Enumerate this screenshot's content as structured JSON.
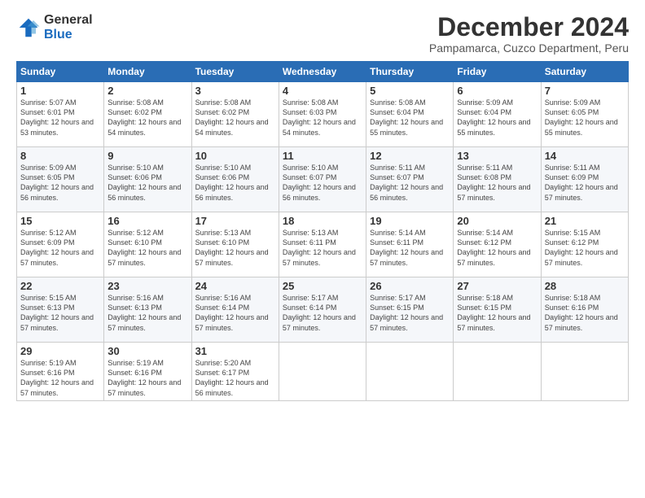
{
  "logo": {
    "general": "General",
    "blue": "Blue"
  },
  "header": {
    "title": "December 2024",
    "subtitle": "Pampamarca, Cuzco Department, Peru"
  },
  "weekdays": [
    "Sunday",
    "Monday",
    "Tuesday",
    "Wednesday",
    "Thursday",
    "Friday",
    "Saturday"
  ],
  "weeks": [
    [
      {
        "day": "1",
        "sunrise": "5:07 AM",
        "sunset": "6:01 PM",
        "daylight": "12 hours and 53 minutes."
      },
      {
        "day": "2",
        "sunrise": "5:08 AM",
        "sunset": "6:02 PM",
        "daylight": "12 hours and 54 minutes."
      },
      {
        "day": "3",
        "sunrise": "5:08 AM",
        "sunset": "6:02 PM",
        "daylight": "12 hours and 54 minutes."
      },
      {
        "day": "4",
        "sunrise": "5:08 AM",
        "sunset": "6:03 PM",
        "daylight": "12 hours and 54 minutes."
      },
      {
        "day": "5",
        "sunrise": "5:08 AM",
        "sunset": "6:04 PM",
        "daylight": "12 hours and 55 minutes."
      },
      {
        "day": "6",
        "sunrise": "5:09 AM",
        "sunset": "6:04 PM",
        "daylight": "12 hours and 55 minutes."
      },
      {
        "day": "7",
        "sunrise": "5:09 AM",
        "sunset": "6:05 PM",
        "daylight": "12 hours and 55 minutes."
      }
    ],
    [
      {
        "day": "8",
        "sunrise": "5:09 AM",
        "sunset": "6:05 PM",
        "daylight": "12 hours and 56 minutes."
      },
      {
        "day": "9",
        "sunrise": "5:10 AM",
        "sunset": "6:06 PM",
        "daylight": "12 hours and 56 minutes."
      },
      {
        "day": "10",
        "sunrise": "5:10 AM",
        "sunset": "6:06 PM",
        "daylight": "12 hours and 56 minutes."
      },
      {
        "day": "11",
        "sunrise": "5:10 AM",
        "sunset": "6:07 PM",
        "daylight": "12 hours and 56 minutes."
      },
      {
        "day": "12",
        "sunrise": "5:11 AM",
        "sunset": "6:07 PM",
        "daylight": "12 hours and 56 minutes."
      },
      {
        "day": "13",
        "sunrise": "5:11 AM",
        "sunset": "6:08 PM",
        "daylight": "12 hours and 57 minutes."
      },
      {
        "day": "14",
        "sunrise": "5:11 AM",
        "sunset": "6:09 PM",
        "daylight": "12 hours and 57 minutes."
      }
    ],
    [
      {
        "day": "15",
        "sunrise": "5:12 AM",
        "sunset": "6:09 PM",
        "daylight": "12 hours and 57 minutes."
      },
      {
        "day": "16",
        "sunrise": "5:12 AM",
        "sunset": "6:10 PM",
        "daylight": "12 hours and 57 minutes."
      },
      {
        "day": "17",
        "sunrise": "5:13 AM",
        "sunset": "6:10 PM",
        "daylight": "12 hours and 57 minutes."
      },
      {
        "day": "18",
        "sunrise": "5:13 AM",
        "sunset": "6:11 PM",
        "daylight": "12 hours and 57 minutes."
      },
      {
        "day": "19",
        "sunrise": "5:14 AM",
        "sunset": "6:11 PM",
        "daylight": "12 hours and 57 minutes."
      },
      {
        "day": "20",
        "sunrise": "5:14 AM",
        "sunset": "6:12 PM",
        "daylight": "12 hours and 57 minutes."
      },
      {
        "day": "21",
        "sunrise": "5:15 AM",
        "sunset": "6:12 PM",
        "daylight": "12 hours and 57 minutes."
      }
    ],
    [
      {
        "day": "22",
        "sunrise": "5:15 AM",
        "sunset": "6:13 PM",
        "daylight": "12 hours and 57 minutes."
      },
      {
        "day": "23",
        "sunrise": "5:16 AM",
        "sunset": "6:13 PM",
        "daylight": "12 hours and 57 minutes."
      },
      {
        "day": "24",
        "sunrise": "5:16 AM",
        "sunset": "6:14 PM",
        "daylight": "12 hours and 57 minutes."
      },
      {
        "day": "25",
        "sunrise": "5:17 AM",
        "sunset": "6:14 PM",
        "daylight": "12 hours and 57 minutes."
      },
      {
        "day": "26",
        "sunrise": "5:17 AM",
        "sunset": "6:15 PM",
        "daylight": "12 hours and 57 minutes."
      },
      {
        "day": "27",
        "sunrise": "5:18 AM",
        "sunset": "6:15 PM",
        "daylight": "12 hours and 57 minutes."
      },
      {
        "day": "28",
        "sunrise": "5:18 AM",
        "sunset": "6:16 PM",
        "daylight": "12 hours and 57 minutes."
      }
    ],
    [
      {
        "day": "29",
        "sunrise": "5:19 AM",
        "sunset": "6:16 PM",
        "daylight": "12 hours and 57 minutes."
      },
      {
        "day": "30",
        "sunrise": "5:19 AM",
        "sunset": "6:16 PM",
        "daylight": "12 hours and 57 minutes."
      },
      {
        "day": "31",
        "sunrise": "5:20 AM",
        "sunset": "6:17 PM",
        "daylight": "12 hours and 56 minutes."
      },
      null,
      null,
      null,
      null
    ]
  ]
}
